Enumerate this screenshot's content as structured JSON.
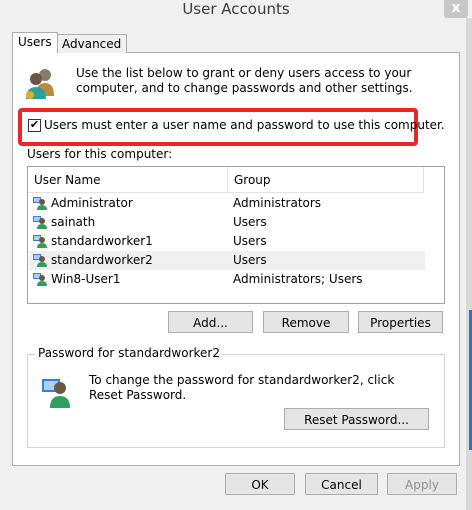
{
  "window": {
    "title": "User Accounts",
    "close_glyph": "x"
  },
  "tabs": [
    {
      "label": "Users"
    },
    {
      "label": "Advanced"
    }
  ],
  "intro_text": "Use the list below to grant or deny users access to your computer, and to change passwords and other settings.",
  "require_login": {
    "checked": true,
    "label": "Users must enter a user name and password to use this computer."
  },
  "users_section_label": "Users for this computer:",
  "list": {
    "columns": {
      "name": "User Name",
      "group": "Group"
    },
    "rows": [
      {
        "name": "Administrator",
        "group": "Administrators",
        "selected": false
      },
      {
        "name": "sainath",
        "group": "Users",
        "selected": false
      },
      {
        "name": "standardworker1",
        "group": "Users",
        "selected": false
      },
      {
        "name": "standardworker2",
        "group": "Users",
        "selected": true
      },
      {
        "name": "Win8-User1",
        "group": "Administrators; Users",
        "selected": false
      }
    ]
  },
  "actions": {
    "add": "Add...",
    "remove": "Remove",
    "properties": "Properties"
  },
  "password_group": {
    "title": "Password for standardworker2",
    "text": "To change the password for standardworker2, click Reset Password.",
    "reset_button": "Reset Password..."
  },
  "footer": {
    "ok": "OK",
    "cancel": "Cancel",
    "apply": "Apply"
  },
  "icons": {
    "users_icon": "users-icon",
    "user_row_icon": "user-icon",
    "password_icon": "user-password-icon"
  },
  "colors": {
    "highlight": "#e8272b",
    "accent": "#2b72c2"
  }
}
